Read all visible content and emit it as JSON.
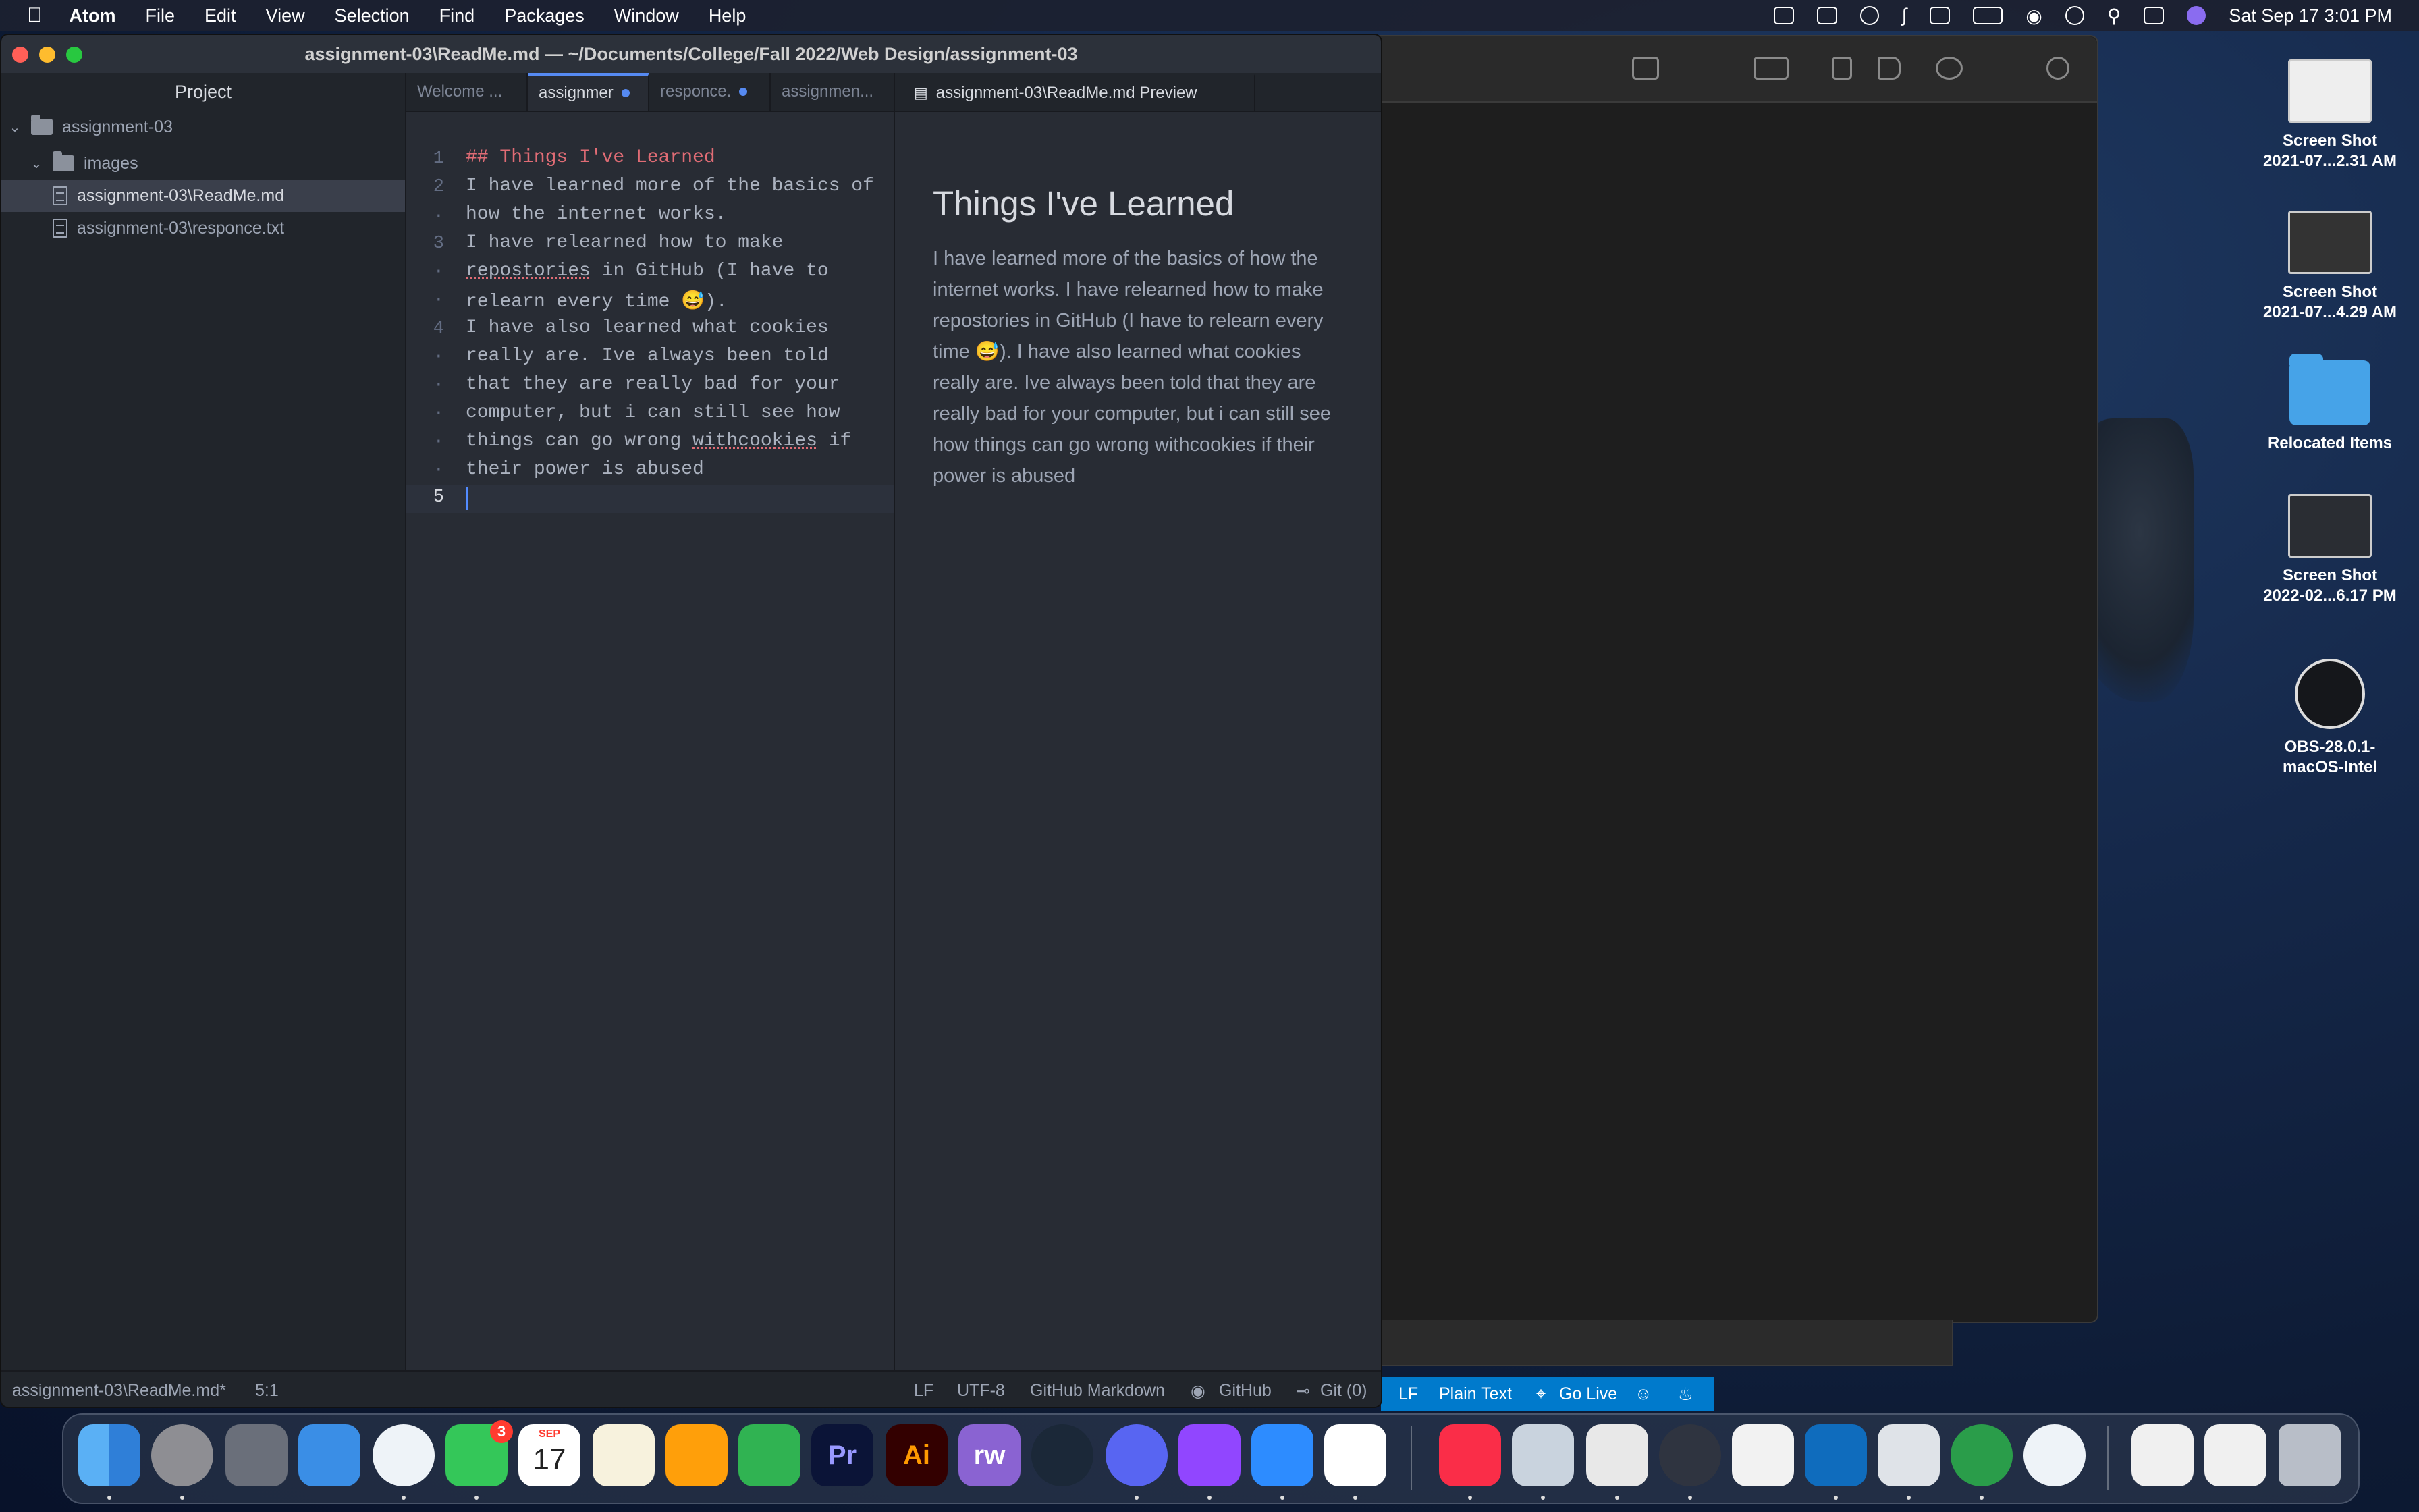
{
  "menubar": {
    "app": "Atom",
    "items": [
      "File",
      "Edit",
      "View",
      "Selection",
      "Find",
      "Packages",
      "Window",
      "Help"
    ],
    "clock": "Sat Sep 17  3:01 PM"
  },
  "atom": {
    "title": "assignment-03\\ReadMe.md — ~/Documents/College/Fall 2022/Web Design/assignment-03",
    "tree": {
      "header": "Project",
      "root": "assignment-03",
      "folder": "images",
      "files": [
        "assignment-03\\ReadMe.md",
        "assignment-03\\responce.txt"
      ]
    },
    "tabs": [
      "Welcome ...",
      "assignmer",
      "responce.",
      "assignmen..."
    ],
    "preview_tab": "assignment-03\\ReadMe.md Preview",
    "editor": {
      "line_numbers": [
        "1",
        "2",
        "3",
        "4",
        "5"
      ],
      "line1": "## Things I've Learned",
      "line2a": "I have learned more of the basics of",
      "line2b": "how the internet works.",
      "line3a": "I have relearned how to make",
      "line3b_word": "repostories",
      "line3b_rest": " in GitHub (I have to",
      "line3c": "relearn every time 😅).",
      "line4a": "I have also learned what cookies",
      "line4b": "really are. Ive always been told",
      "line4c": "that they are really bad for your",
      "line4d": "computer, but i can still see how",
      "line4e_pre": "things can go wrong ",
      "line4e_word": "withcookies",
      "line4e_post": " if",
      "line4f": "their power is abused"
    },
    "preview": {
      "heading": "Things I've Learned",
      "paragraph": "I have learned more of the basics of how the internet works. I have relearned how to make repostories in GitHub (I have to relearn every time 😅). I have also learned what cookies really are. Ive always been told that they are really bad for your computer, but i can still see how things can go wrong withcookies if their power is abused"
    },
    "status": {
      "file": "assignment-03\\ReadMe.md*",
      "cursor": "5:1",
      "eol": "LF",
      "encoding": "UTF-8",
      "grammar": "GitHub Markdown",
      "github": "GitHub",
      "git": "Git (0)"
    }
  },
  "vscode_status": {
    "eol": "LF",
    "mode": "Plain Text",
    "golive": "Go Live"
  },
  "desktop": {
    "icons": [
      {
        "label1": "Screen Shot",
        "label2": "2021-07...2.31 AM"
      },
      {
        "label1": "Screen Shot",
        "label2": "2021-07...4.29 AM"
      },
      {
        "label1": "Relocated Items",
        "label2": ""
      },
      {
        "label1": "Screen Shot",
        "label2": "2022-02...6.17 PM"
      },
      {
        "label1": "OBS-28.0.1-",
        "label2": "macOS-Intel"
      }
    ]
  },
  "dock": {
    "calendar_month": "SEP",
    "calendar_day": "17",
    "messages_badge": "3",
    "premiere": "Pr",
    "illustrator": "Ai",
    "rw": "rw"
  }
}
